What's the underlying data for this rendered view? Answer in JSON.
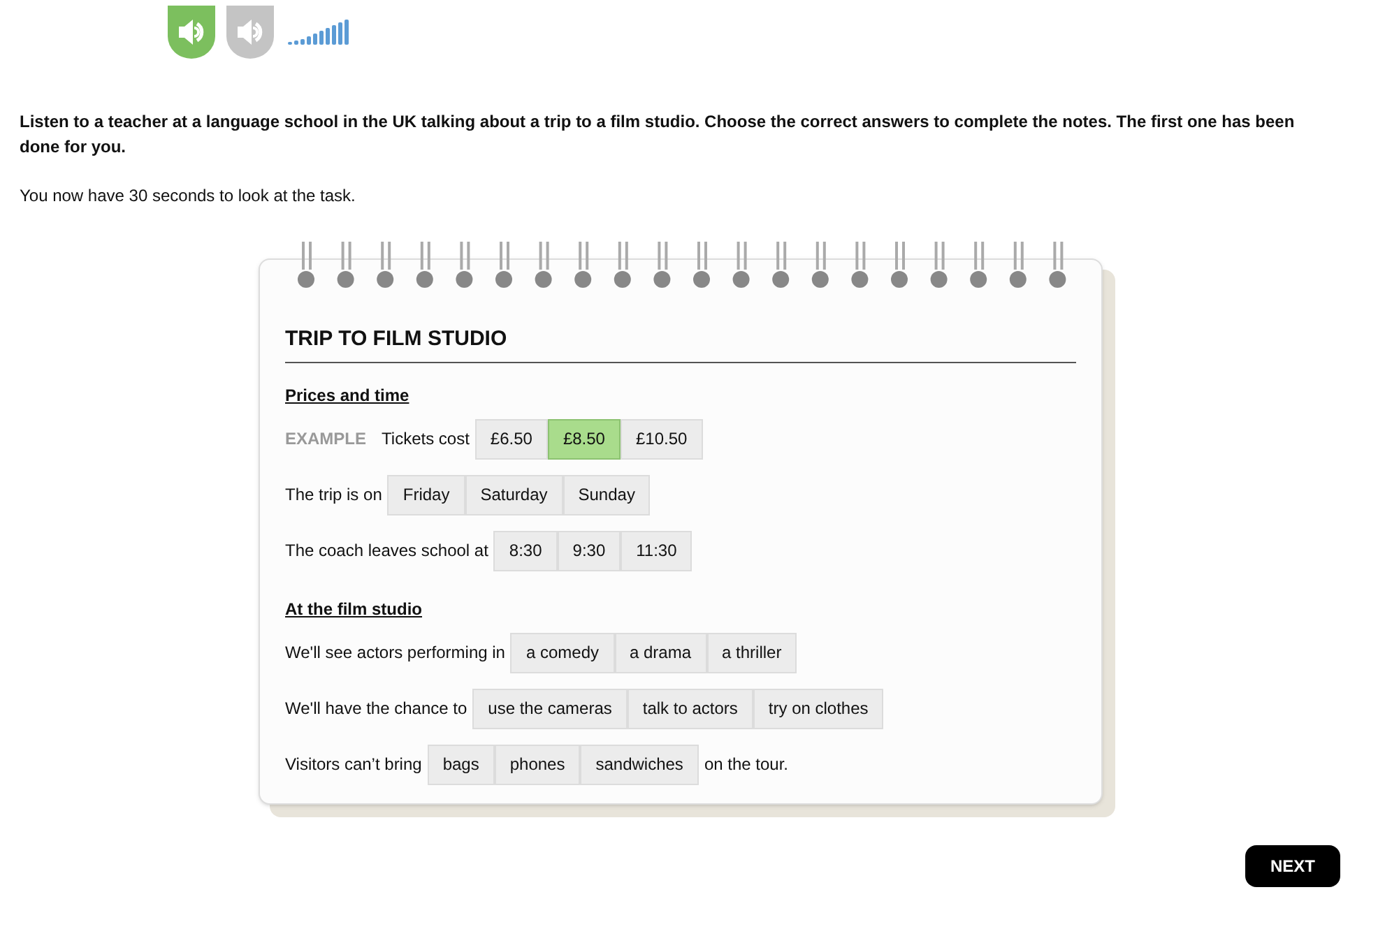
{
  "instructions": "Listen to a teacher at a language school in the UK talking about a trip to a film studio. Choose the correct answers to complete the notes. The first one has been done for you.",
  "timer_note": "You now have 30 seconds to look at the task.",
  "notes": {
    "title": "TRIP TO FILM STUDIO",
    "sections": [
      {
        "heading": "Prices and time",
        "rows": [
          {
            "example": "EXAMPLE",
            "prompt": "Tickets cost",
            "options": [
              {
                "label": "£6.50",
                "selected": false
              },
              {
                "label": "£8.50",
                "selected": true
              },
              {
                "label": "£10.50",
                "selected": false
              }
            ]
          },
          {
            "prompt": "The trip is on",
            "options": [
              {
                "label": "Friday",
                "selected": false
              },
              {
                "label": "Saturday",
                "selected": false
              },
              {
                "label": "Sunday",
                "selected": false
              }
            ]
          },
          {
            "prompt": "The coach leaves school at",
            "options": [
              {
                "label": "8:30",
                "selected": false
              },
              {
                "label": "9:30",
                "selected": false
              },
              {
                "label": "11:30",
                "selected": false
              }
            ]
          }
        ]
      },
      {
        "heading": "At the film studio",
        "rows": [
          {
            "prompt": "We'll see actors performing in",
            "options": [
              {
                "label": "a comedy",
                "selected": false
              },
              {
                "label": "a drama",
                "selected": false
              },
              {
                "label": "a thriller",
                "selected": false
              }
            ]
          },
          {
            "prompt": "We'll have the chance to",
            "options": [
              {
                "label": "use the cameras",
                "selected": false
              },
              {
                "label": "talk to actors",
                "selected": false
              },
              {
                "label": "try on clothes",
                "selected": false
              }
            ]
          },
          {
            "prompt": "Visitors can’t bring",
            "options": [
              {
                "label": "bags",
                "selected": false
              },
              {
                "label": "phones",
                "selected": false
              },
              {
                "label": "sandwiches",
                "selected": false
              }
            ],
            "suffix": "on the tour."
          }
        ]
      }
    ]
  },
  "next_button": "NEXT"
}
